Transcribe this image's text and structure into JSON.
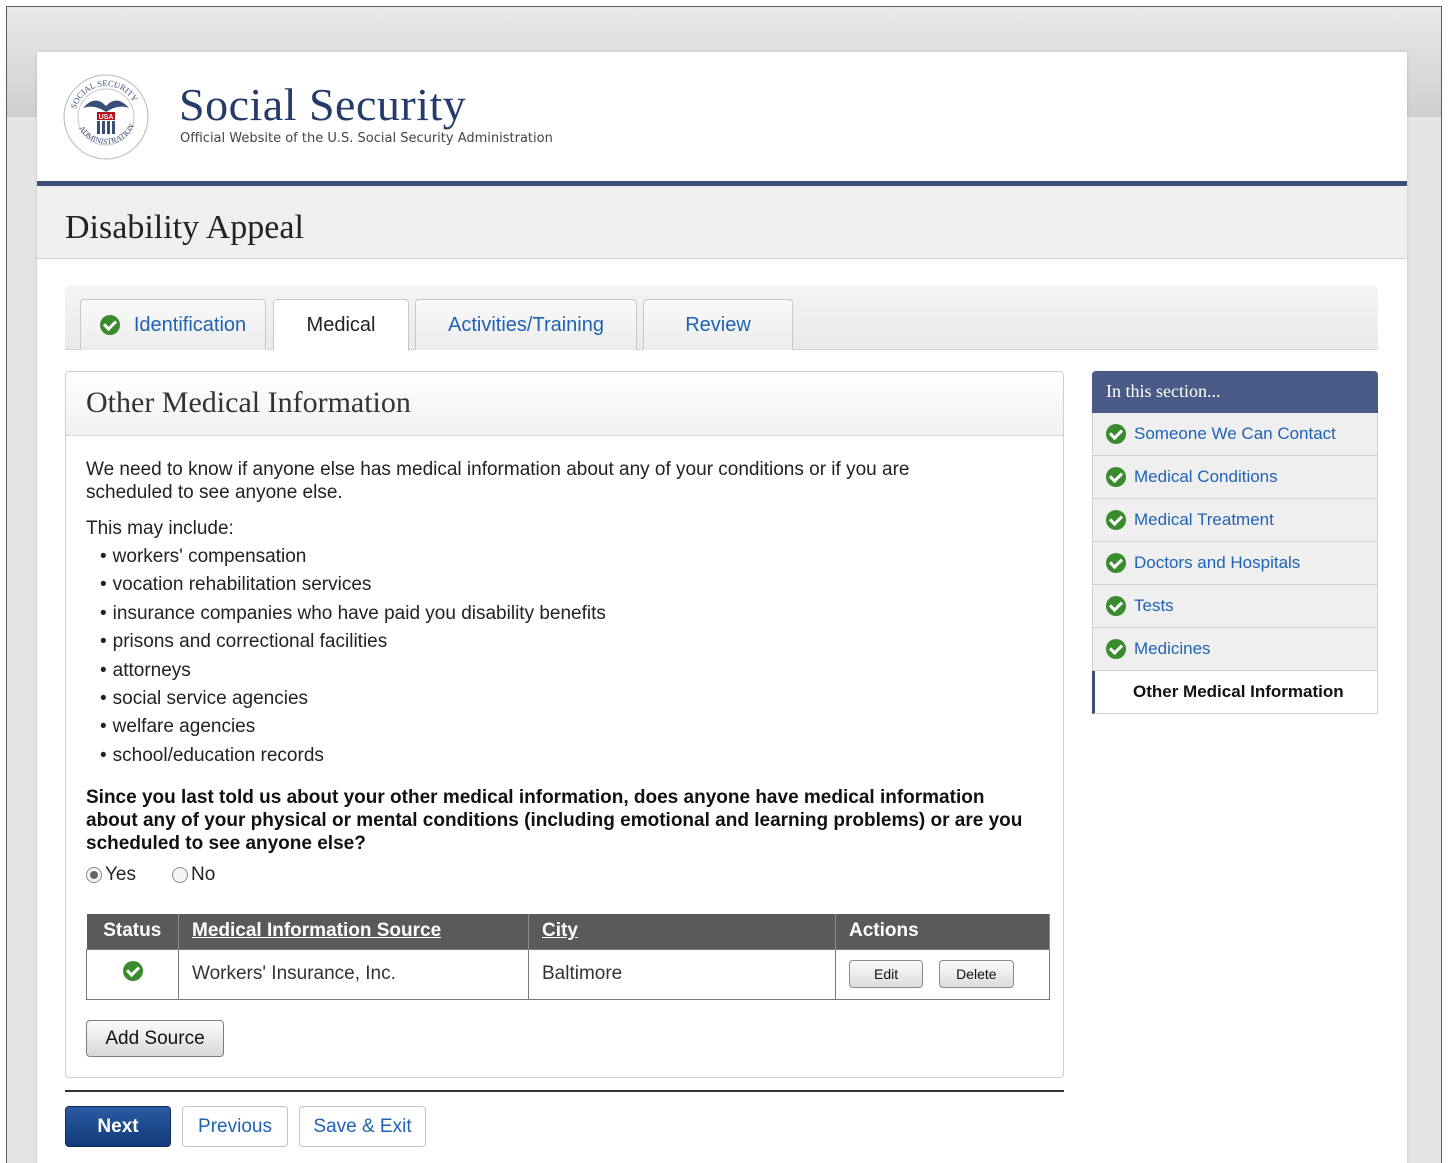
{
  "header": {
    "site_title": "Social Security",
    "site_subtitle": "Official Website of the U.S. Social Security Administration",
    "seal_label": "USA"
  },
  "page_title": "Disability Appeal",
  "tabs": [
    {
      "label": "Identification",
      "completed": true
    },
    {
      "label": "Medical",
      "active": true
    },
    {
      "label": "Activities/Training"
    },
    {
      "label": "Review"
    }
  ],
  "panel": {
    "title": "Other Medical Information",
    "intro": "We need to know if anyone else has medical information about any of your conditions or if you are scheduled to see anyone else.",
    "may_include": "This may include:",
    "bullets": [
      "workers' compensation",
      "vocation rehabilitation services",
      "insurance companies who have paid you disability benefits",
      "prisons and correctional facilities",
      "attorneys",
      "social service agencies",
      "welfare agencies",
      "school/education records"
    ],
    "question": "Since you last told us about your other medical information, does anyone have medical information about any of your physical or mental conditions (including emotional and learning problems) or are you scheduled to see anyone else?",
    "answer_yes": "Yes",
    "answer_no": "No",
    "selected_answer": "Yes"
  },
  "table": {
    "headers": [
      "Status",
      "Medical Information Source",
      "City",
      "Actions"
    ],
    "rows": [
      {
        "status": "complete",
        "source": "Workers' Insurance, Inc.",
        "city": "Baltimore",
        "edit_label": "Edit",
        "delete_label": "Delete"
      }
    ]
  },
  "add_source_label": "Add Source",
  "nav": {
    "next": "Next",
    "previous": "Previous",
    "save_exit": "Save & Exit"
  },
  "sidebar": {
    "title": "In this section...",
    "items": [
      {
        "label": "Someone We Can Contact",
        "completed": true
      },
      {
        "label": "Medical Conditions",
        "completed": true
      },
      {
        "label": "Medical Treatment",
        "completed": true
      },
      {
        "label": "Doctors and Hospitals",
        "completed": true
      },
      {
        "label": "Tests",
        "completed": true
      },
      {
        "label": "Medicines",
        "completed": true
      },
      {
        "label": "Other Medical Information",
        "current": true
      }
    ]
  },
  "colors": {
    "brand_navy": "#243b6b",
    "header_rule": "#3e4f78",
    "link_blue": "#1f62b5",
    "check_green": "#3a8b2d",
    "table_header": "#5a5a5a"
  }
}
